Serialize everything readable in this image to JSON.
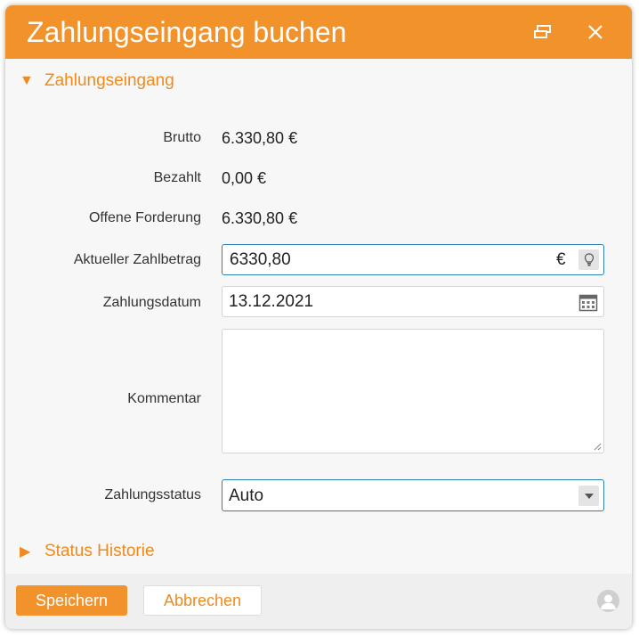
{
  "dialog": {
    "title": "Zahlungseingang buchen",
    "restore_icon": "restore-window-icon",
    "close_icon": "close-icon"
  },
  "section_payment": {
    "label": "Zahlungseingang",
    "icon": "triangle-down-icon"
  },
  "fields": {
    "brutto": {
      "label": "Brutto",
      "value": "6.330,80 €"
    },
    "bezahlt": {
      "label": "Bezahlt",
      "value": "0,00 €"
    },
    "offen": {
      "label": "Offene Forderung",
      "value": "6.330,80 €"
    },
    "betrag": {
      "label": "Aktueller Zahlbetrag",
      "value": "6330,80",
      "currency": "€",
      "icon": "lightbulb-icon"
    },
    "datum": {
      "label": "Zahlungsdatum",
      "value": "13.12.2021",
      "icon": "calendar-icon"
    },
    "kommentar": {
      "label": "Kommentar",
      "value": ""
    },
    "status": {
      "label": "Zahlungsstatus",
      "value": "Auto",
      "icon": "dropdown-arrow-icon"
    }
  },
  "section_history": {
    "label": "Status Historie",
    "icon": "triangle-right-icon"
  },
  "footer": {
    "save_label": "Speichern",
    "cancel_label": "Abbrechen",
    "user_icon": "user-icon"
  },
  "colors": {
    "accent": "#f2922a",
    "focus_border": "#2f7fb0",
    "section_text": "#ef8a1e"
  }
}
